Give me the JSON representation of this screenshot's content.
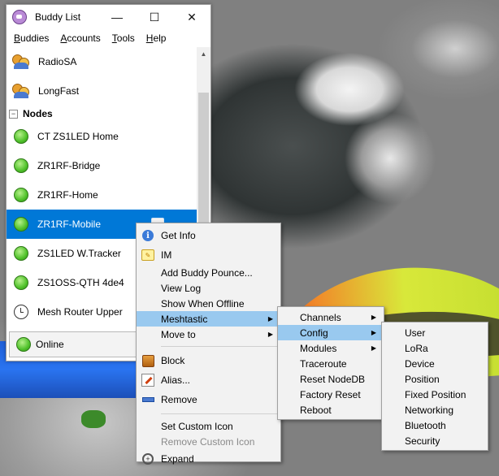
{
  "window": {
    "title": "Buddy List",
    "controls": {
      "minimize": "—",
      "maximize": "☐",
      "close": "✕"
    }
  },
  "menubar": [
    {
      "key": "B",
      "rest": "uddies"
    },
    {
      "key": "A",
      "rest": "ccounts"
    },
    {
      "key": "T",
      "rest": "ools"
    },
    {
      "key": "H",
      "rest": "elp"
    }
  ],
  "buddies": {
    "chats": [
      "RadioSA",
      "LongFast"
    ],
    "group_label": "Nodes",
    "group_expander": "−",
    "nodes": [
      {
        "name": "CT ZS1LED Home",
        "status": "online"
      },
      {
        "name": "ZR1RF-Bridge",
        "status": "online"
      },
      {
        "name": "ZR1RF-Home",
        "status": "online"
      },
      {
        "name": "ZR1RF-Mobile",
        "status": "online",
        "selected": true
      },
      {
        "name": "ZS1LED W.Tracker",
        "status": "online"
      },
      {
        "name": "ZS1OSS-QTH 4de4",
        "status": "online"
      },
      {
        "name": "Mesh Router Upper",
        "status": "idle"
      }
    ]
  },
  "status": {
    "label": "Online"
  },
  "context_menu": {
    "items": [
      {
        "label": "Get Info",
        "icon": "info-icon"
      },
      {
        "label": "IM",
        "icon": "im-icon"
      },
      {
        "label": "Add Buddy Pounce..."
      },
      {
        "label": "View Log"
      },
      {
        "label": "Show When Offline"
      },
      {
        "label": "Meshtastic",
        "submenu": true,
        "highlight": true
      },
      {
        "label": "Move to",
        "submenu": true
      },
      {
        "label": "Block",
        "icon": "block-icon"
      },
      {
        "label": "Alias...",
        "icon": "alias-icon"
      },
      {
        "label": "Remove",
        "icon": "remove-icon"
      },
      {
        "label": "Set Custom Icon"
      },
      {
        "label": "Remove Custom Icon",
        "disabled": true
      },
      {
        "label": "Expand",
        "icon": "expand-icon"
      }
    ]
  },
  "meshtastic_menu": {
    "items": [
      "Channels",
      "Config",
      "Modules",
      "Traceroute",
      "Reset NodeDB",
      "Factory Reset",
      "Reboot"
    ]
  },
  "config_menu": {
    "items": [
      "User",
      "LoRa",
      "Device",
      "Position",
      "Fixed Position",
      "Networking",
      "Bluetooth",
      "Security"
    ]
  },
  "colors": {
    "selection": "#0078d7",
    "menu_highlight": "#99c9ef",
    "menu_bg": "#f2f2f2"
  }
}
